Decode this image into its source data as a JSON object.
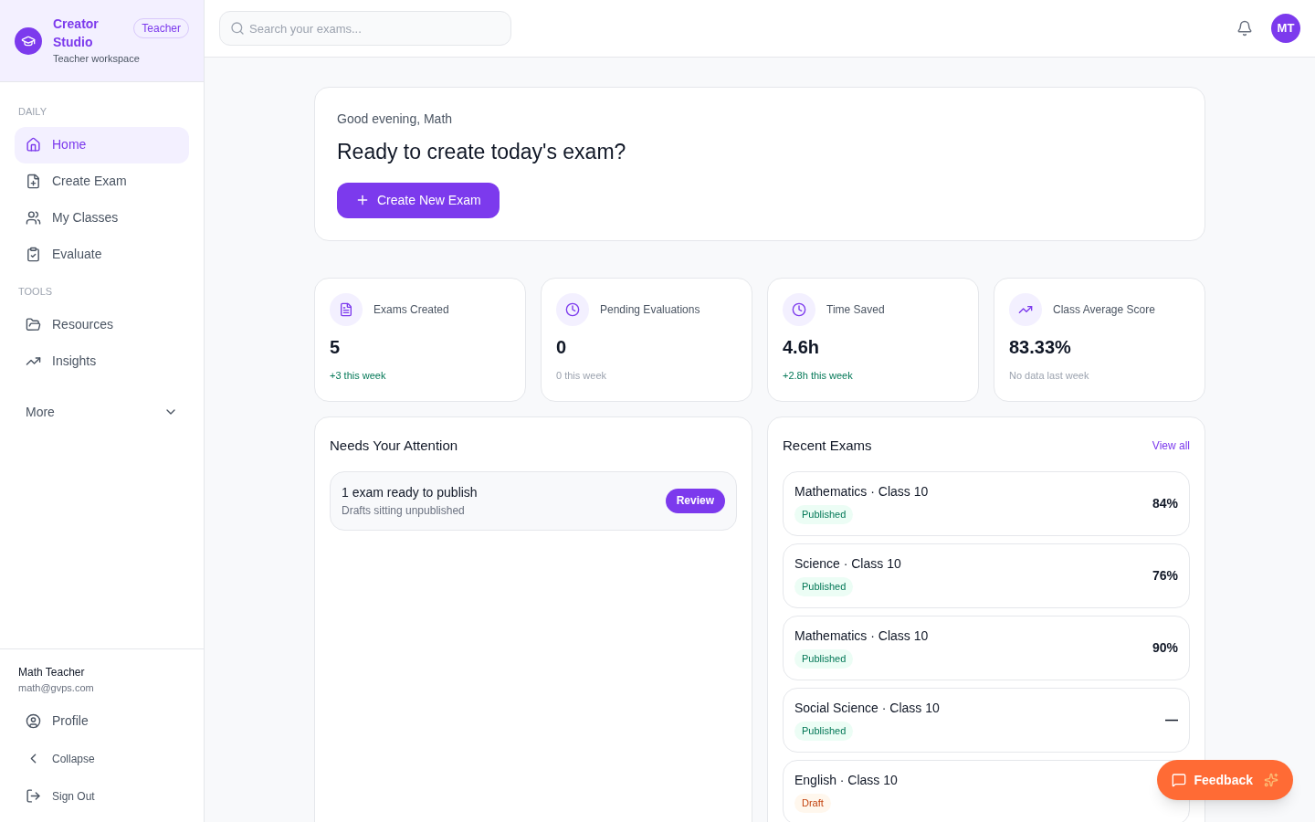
{
  "brand": {
    "name": "Creator Studio",
    "badge": "Teacher",
    "subtitle": "Teacher workspace"
  },
  "sidebar": {
    "sections": [
      {
        "title": "DAILY",
        "items": [
          {
            "label": "Home",
            "kind": "home",
            "selected": true
          },
          {
            "label": "Create Exam",
            "kind": "create",
            "selected": false
          },
          {
            "label": "My Classes",
            "kind": "classes",
            "selected": false
          },
          {
            "label": "Evaluate",
            "kind": "evaluate",
            "selected": false
          }
        ]
      },
      {
        "title": "TOOLS",
        "items": [
          {
            "label": "Resources",
            "kind": "resources",
            "selected": false
          },
          {
            "label": "Insights",
            "kind": "insights",
            "selected": false
          }
        ]
      }
    ],
    "more": {
      "label": "More",
      "expanded": false
    },
    "user": {
      "name": "Math Teacher",
      "email": "math@gvps.com"
    },
    "footer_items": [
      {
        "label": "Profile",
        "kind": "profile"
      },
      {
        "label": "Collapse",
        "kind": "collapse"
      },
      {
        "label": "Sign Out",
        "kind": "signout"
      }
    ]
  },
  "search": {
    "placeholder": "Search your exams..."
  },
  "avatar": "MT",
  "greeting": {
    "subtitle": "Good evening, Math",
    "title": "Ready to create today's exam?",
    "button": "Create New Exam"
  },
  "stats": [
    {
      "label": "Exams Created",
      "kind": "exams",
      "value": "5",
      "change": "+3 this week",
      "positive": true
    },
    {
      "label": "Pending Evaluations",
      "kind": "pending",
      "value": "0",
      "change": "0 this week",
      "positive": false
    },
    {
      "label": "Time Saved",
      "kind": "time",
      "value": "4.6h",
      "change": "+2.8h this week",
      "positive": true
    },
    {
      "label": "Class Average Score",
      "kind": "score",
      "value": "83.33%",
      "change": "No data last week",
      "positive": false
    }
  ],
  "attention": {
    "title": "Needs Your Attention",
    "items": [
      {
        "title": "1 exam ready to publish",
        "subtitle": "Drafts sitting unpublished",
        "button": "Review"
      }
    ]
  },
  "recent": {
    "title": "Recent Exams",
    "link": "View all",
    "exams": [
      {
        "name": "Mathematics · Class 10",
        "status": "Published",
        "kind": "published",
        "score": "84%"
      },
      {
        "name": "Science · Class 10",
        "status": "Published",
        "kind": "published",
        "score": "76%"
      },
      {
        "name": "Mathematics · Class 10",
        "status": "Published",
        "kind": "published",
        "score": "90%"
      },
      {
        "name": "Social Science · Class 10",
        "status": "Published",
        "kind": "published",
        "score": "—"
      },
      {
        "name": "English · Class 10",
        "status": "Draft",
        "kind": "draft"
      }
    ]
  },
  "feedback": "Feedback"
}
